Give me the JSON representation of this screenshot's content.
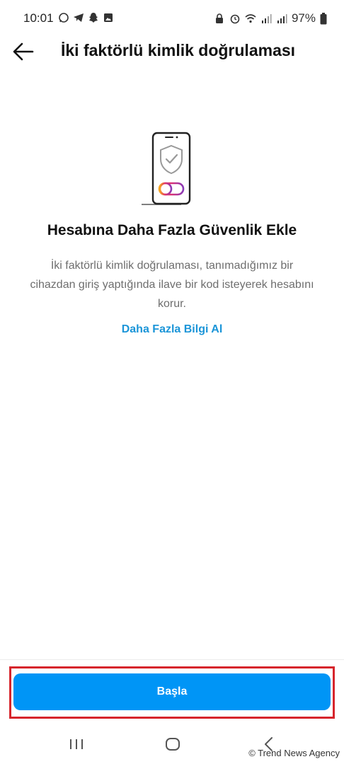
{
  "status_bar": {
    "time": "10:01",
    "left_icons": [
      "whatsapp-icon",
      "telegram-icon",
      "snapchat-icon",
      "gallery-icon"
    ],
    "right_icons": [
      "lock-icon",
      "alarm-icon",
      "wifi-icon",
      "signal-icon",
      "signal-icon",
      "battery-icon"
    ],
    "battery_percent": "97%"
  },
  "header": {
    "back_icon": "arrow-left-icon",
    "title": "İki faktörlü kimlik doğrulaması"
  },
  "main": {
    "illustration_icon": "phone-shield-icon",
    "headline": "Hesabına Daha Fazla Güvenlik Ekle",
    "description": "İki faktörlü kimlik doğrulaması, tanımadığımız bir cihazdan giriş yaptığında ilave bir kod isteyerek hesabını korur.",
    "learn_more_link": "Daha Fazla Bilgi Al"
  },
  "footer": {
    "start_button": "Başla",
    "highlight_color": "#d6252c",
    "button_color": "#0095f6"
  },
  "nav_bar": {
    "icons": [
      "recent-apps-icon",
      "home-icon",
      "back-icon"
    ]
  },
  "watermark": "© Trend News Agency"
}
